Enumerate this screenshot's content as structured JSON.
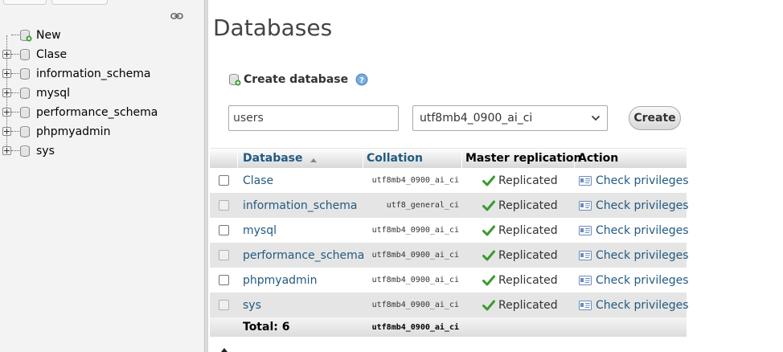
{
  "sidebar": {
    "items": [
      {
        "label": "New",
        "type": "new"
      },
      {
        "label": "Clase",
        "type": "db"
      },
      {
        "label": "information_schema",
        "type": "db"
      },
      {
        "label": "mysql",
        "type": "db"
      },
      {
        "label": "performance_schema",
        "type": "db"
      },
      {
        "label": "phpmyadmin",
        "type": "db"
      },
      {
        "label": "sys",
        "type": "db"
      }
    ]
  },
  "main": {
    "title": "Databases",
    "create": {
      "heading": "Create database",
      "name_value": "users",
      "collation_value": "utf8mb4_0900_ai_ci",
      "button_label": "Create"
    },
    "table": {
      "headers": {
        "database": "Database",
        "collation": "Collation",
        "replication": "Master replication",
        "action": "Action"
      },
      "rows": [
        {
          "name": "Clase",
          "collation": "utf8mb4_0900_ai_ci",
          "replication": "Replicated",
          "action": "Check privileges"
        },
        {
          "name": "information_schema",
          "collation": "utf8_general_ci",
          "replication": "Replicated",
          "action": "Check privileges"
        },
        {
          "name": "mysql",
          "collation": "utf8mb4_0900_ai_ci",
          "replication": "Replicated",
          "action": "Check privileges"
        },
        {
          "name": "performance_schema",
          "collation": "utf8mb4_0900_ai_ci",
          "replication": "Replicated",
          "action": "Check privileges"
        },
        {
          "name": "phpmyadmin",
          "collation": "utf8mb4_0900_ai_ci",
          "replication": "Replicated",
          "action": "Check privileges"
        },
        {
          "name": "sys",
          "collation": "utf8mb4_0900_ai_ci",
          "replication": "Replicated",
          "action": "Check privileges"
        }
      ],
      "total_label": "Total: 6",
      "total_collation": "utf8mb4_0900_ai_ci"
    }
  },
  "colors": {
    "link": "#235a81",
    "check_green": "#3a9a2e",
    "sidebar_bg": "#f3f3f3"
  }
}
